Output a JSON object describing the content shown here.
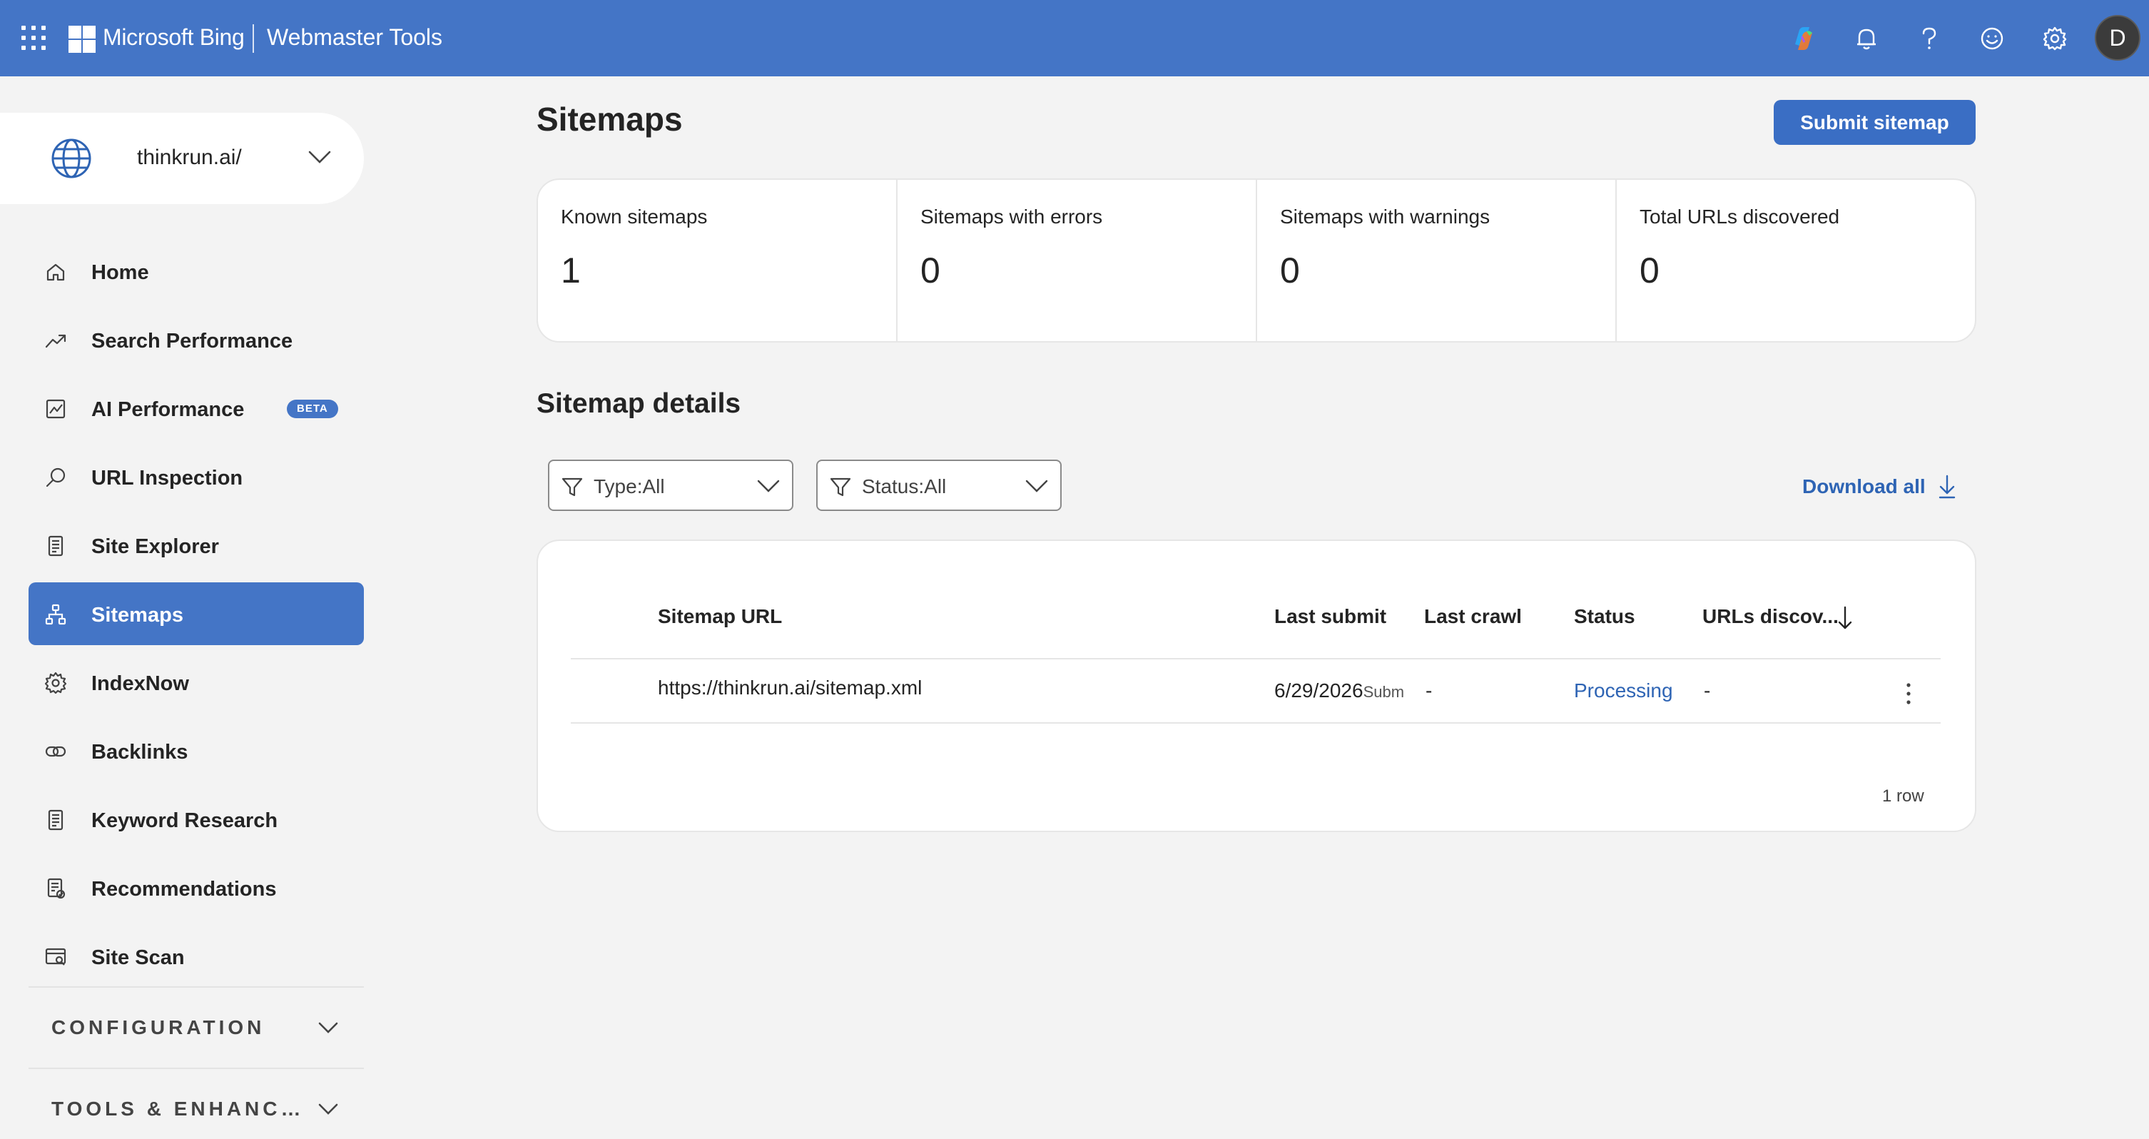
{
  "header": {
    "brand": "Microsoft Bing",
    "product": "Webmaster Tools",
    "avatar_initial": "D",
    "icons": [
      "app-launcher-icon",
      "copilot-icon",
      "bell-icon",
      "help-icon",
      "feedback-smiley-icon",
      "gear-icon"
    ]
  },
  "sidebar": {
    "site": "thinkrun.ai/",
    "items": [
      {
        "label": "Home",
        "icon": "home-icon"
      },
      {
        "label": "Search Performance",
        "icon": "trend-icon"
      },
      {
        "label": "AI Performance",
        "icon": "chart-icon",
        "badge": "BETA"
      },
      {
        "label": "URL Inspection",
        "icon": "search-icon"
      },
      {
        "label": "Site Explorer",
        "icon": "document-icon"
      },
      {
        "label": "Sitemaps",
        "icon": "sitemap-icon",
        "active": true
      },
      {
        "label": "IndexNow",
        "icon": "gear-icon"
      },
      {
        "label": "Backlinks",
        "icon": "link-icon"
      },
      {
        "label": "Keyword Research",
        "icon": "document-icon"
      },
      {
        "label": "Recommendations",
        "icon": "checklist-icon"
      },
      {
        "label": "Site Scan",
        "icon": "scan-icon"
      }
    ],
    "sections": [
      {
        "label": "CONFIGURATION"
      },
      {
        "label": "TOOLS & ENHANC…"
      }
    ]
  },
  "main": {
    "title": "Sitemaps",
    "submit_label": "Submit sitemap",
    "stats": [
      {
        "label": "Known sitemaps",
        "value": "1"
      },
      {
        "label": "Sitemaps with errors",
        "value": "0"
      },
      {
        "label": "Sitemaps with warnings",
        "value": "0"
      },
      {
        "label": "Total URLs discovered",
        "value": "0"
      }
    ],
    "details_title": "Sitemap details",
    "filters": [
      {
        "label": "Type:All"
      },
      {
        "label": "Status:All"
      }
    ],
    "download_label": "Download all",
    "table": {
      "columns": [
        "Sitemap URL",
        "Last submit",
        "Last crawl",
        "Status",
        "URLs discov..."
      ],
      "rows": [
        {
          "url": "https://thinkrun.ai/sitemap.xml",
          "last_submit": "6/29/2026",
          "last_submit_sub": "Subm",
          "last_crawl": "-",
          "status": "Processing",
          "urls": "-"
        }
      ],
      "row_count": "1 row"
    }
  },
  "colors": {
    "accent": "#4475c6",
    "button": "#3a6ec4",
    "link": "#2e64b4",
    "background": "#f3f3f3"
  }
}
